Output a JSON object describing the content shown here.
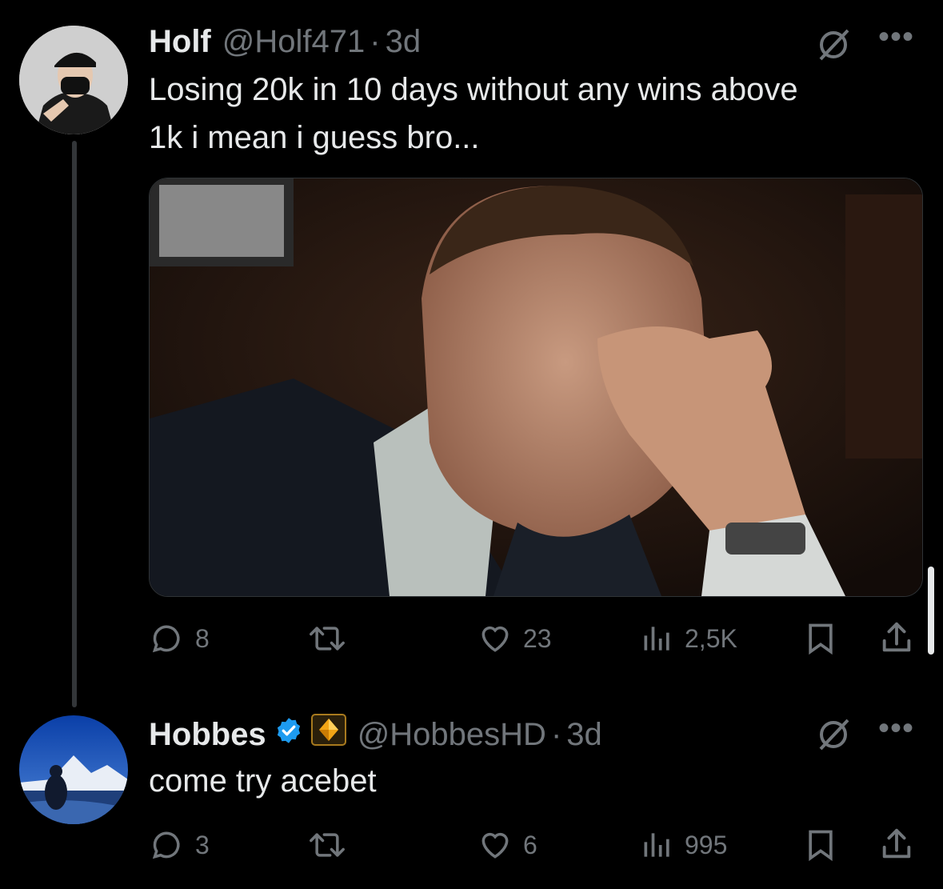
{
  "tweets": [
    {
      "name": "Holf",
      "handle": "@Holf471",
      "separator": "·",
      "time": "3d",
      "text_line1": "Losing 20k in 10 days without any wins above",
      "text_line2": "1k i mean i guess bro...",
      "has_media": true,
      "actions": {
        "replies": "8",
        "retweets": "",
        "likes": "23",
        "views": "2,5K"
      }
    },
    {
      "name": "Hobbes",
      "handle": "@HobbesHD",
      "separator": "·",
      "time": "3d",
      "text": "come try acebet",
      "verified": true,
      "affiliate_badge": "acebet-diamond",
      "actions": {
        "replies": "3",
        "retweets": "",
        "likes": "6",
        "views": "995"
      }
    }
  ],
  "icons": {
    "more": "more-icon",
    "grok": "grok-icon",
    "reply": "reply-icon",
    "retweet": "retweet-icon",
    "like": "like-icon",
    "views": "views-icon",
    "bookmark": "bookmark-icon",
    "share": "share-icon"
  },
  "colors": {
    "background": "#000000",
    "text": "#e7e9ea",
    "muted": "#71767b",
    "verified": "#1d9bf0"
  }
}
